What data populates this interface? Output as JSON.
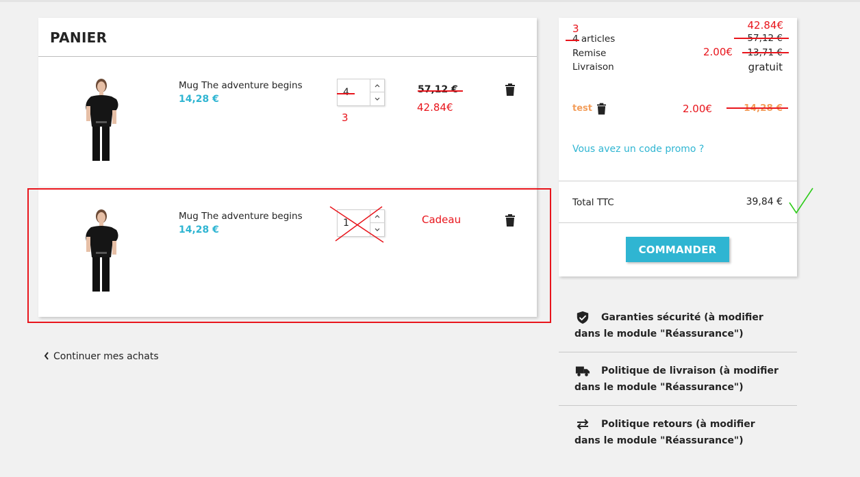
{
  "cart": {
    "title": "PANIER",
    "items": [
      {
        "name": "Mug The adventure begins",
        "price": "14,28 €",
        "quantity": "4",
        "line_total": "57,12 €",
        "annotation_qty": "3",
        "annotation_total": "42.84€"
      },
      {
        "name": "Mug The adventure begins",
        "price": "14,28 €",
        "quantity": "1",
        "annotation_label": "Cadeau"
      }
    ]
  },
  "continue_shopping": "Continuer mes achats",
  "summary": {
    "articles_label": "4 articles",
    "articles_value": "57,12 €",
    "discount_label": "Remise",
    "discount_value": "13,71 €",
    "shipping_label": "Livraison",
    "shipping_value": "gratuit",
    "voucher_name": "test",
    "voucher_value": "14,28 €",
    "promo_link": "Vous avez un code promo ?",
    "total_label": "Total TTC",
    "total_value": "39,84 €",
    "checkout_button": "COMMANDER",
    "annotations": {
      "articles_count": "3",
      "articles_value": "42.84€",
      "discount_value": "2.00€",
      "voucher_value": "2.00€"
    }
  },
  "reassurance": [
    {
      "icon": "shield-check-icon",
      "text": "Garanties sécurité (à modifier dans le module \"Réassurance\")"
    },
    {
      "icon": "truck-icon",
      "text": "Politique de livraison (à modifier dans le module \"Réassurance\")"
    },
    {
      "icon": "swap-arrows-icon",
      "text": "Politique retours (à modifier dans le module \"Réassurance\")"
    }
  ],
  "colors": {
    "accent": "#2fb5d2",
    "voucher": "#f39d5a",
    "annotation_red": "#e8141b",
    "annotation_green": "#2ecc1a",
    "background": "#f1f1f1"
  }
}
